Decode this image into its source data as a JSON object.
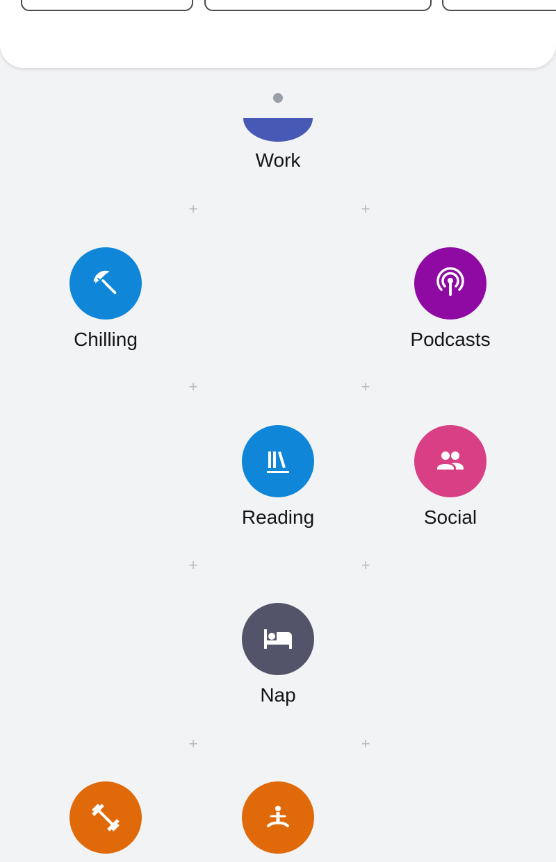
{
  "top_chips": [
    {
      "label": ""
    },
    {
      "label": ""
    },
    {
      "label": ""
    }
  ],
  "activities": {
    "work": {
      "label": "Work",
      "color": "#4759b5"
    },
    "chilling": {
      "label": "Chilling",
      "color": "#0f86d8",
      "icon": "beach-umbrella-icon"
    },
    "podcasts": {
      "label": "Podcasts",
      "color": "#8e0aa3",
      "icon": "podcast-icon"
    },
    "reading": {
      "label": "Reading",
      "color": "#0f86d8",
      "icon": "books-icon"
    },
    "social": {
      "label": "Social",
      "color": "#d93f84",
      "icon": "people-icon"
    },
    "nap": {
      "label": "Nap",
      "color": "#535369",
      "icon": "bed-icon"
    },
    "workout": {
      "label": "",
      "color": "#e06a0a",
      "icon": "dumbbell-icon"
    },
    "meditation": {
      "label": "",
      "color": "#e06a0a",
      "icon": "meditation-icon"
    }
  },
  "add_marker": "+"
}
